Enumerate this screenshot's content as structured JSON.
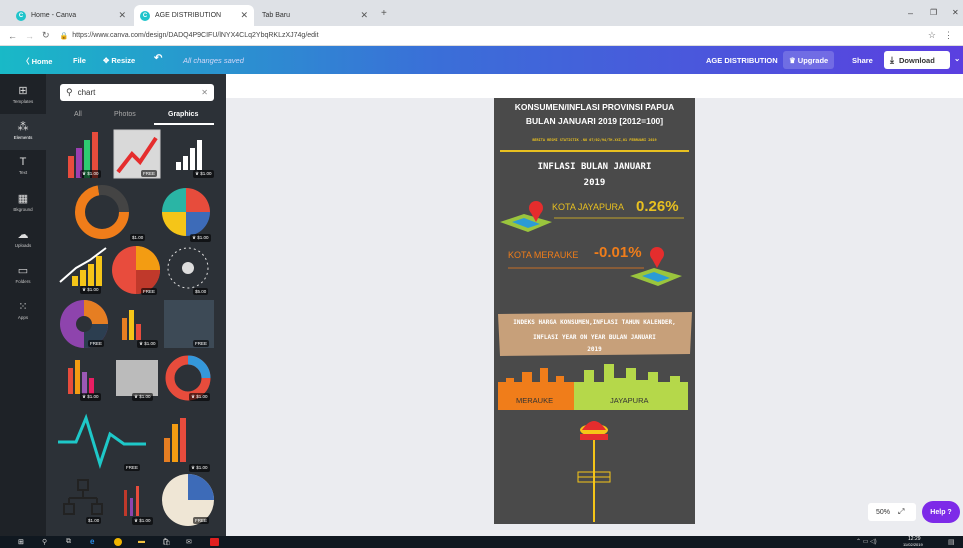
{
  "browser": {
    "tabs": [
      {
        "label": "Home - Canva"
      },
      {
        "label": "AGE DISTRIBUTION"
      },
      {
        "label": "Tab Baru"
      }
    ],
    "new_tab": "+",
    "url": "https://www.canva.com/design/DADQ4P9CIFU/lNYX4CLq2YbqRKLzXJ74g/edit",
    "window_controls": {
      "min": "–",
      "max": "❐",
      "close": "✕"
    }
  },
  "topbar": {
    "home": "〈 Home",
    "file": "File",
    "resize": "✥ Resize",
    "undo": "↶",
    "saved": "All changes saved",
    "title": "AGE DISTRIBUTION",
    "upgrade": "♛ Upgrade",
    "share": "Share",
    "download": "Download"
  },
  "rail": [
    {
      "label": "Templates",
      "icon": "⊞"
    },
    {
      "label": "Elements",
      "icon": "⁂"
    },
    {
      "label": "Text",
      "icon": "T"
    },
    {
      "label": "Bkground",
      "icon": "▦"
    },
    {
      "label": "Uploads",
      "icon": "☁"
    },
    {
      "label": "Folders",
      "icon": "▭"
    },
    {
      "label": "Apps",
      "icon": "⁙"
    }
  ],
  "panel": {
    "search_value": "chart",
    "tabs": [
      "All",
      "Photos",
      "Graphics"
    ],
    "price_labels": [
      "♛ $1.00",
      "FREE",
      "♛ $1.00",
      "$1.00",
      "♛ $1.00",
      "♛ $1.00",
      "FREE",
      "$5.00",
      "FREE",
      "♛ $1.00",
      "FREE",
      "♛ $1.00",
      "♛ $1.00",
      "♛ $1.00",
      "FREE",
      "♛ $1.00",
      "$1.00",
      "♛ $1.00",
      "FREE"
    ]
  },
  "design": {
    "title_line1": "KONSUMEN/INFLASI PROVINSI PAPUA",
    "title_line2": "BULAN JANUARI 2019 [2012=100]",
    "subtitle": "BERITA RESMI STATISTIK .NO 07/02/94/TH.XXI,01 FEBRUARI 2019",
    "heading1": "INFLASI BULAN JANUARI",
    "heading2": "2019",
    "city1_label": "KOTA JAYAPURA",
    "city1_value": "0.26%",
    "city2_label": "KOTA MERAUKE",
    "city2_value": "-0.01%",
    "banner1": "INDEKS HARGA KONSUMEN,INFLASI TAHUN KALENDER,",
    "banner2": "INFLASI YEAR ON YEAR BULAN JANUARI",
    "banner3": "2019",
    "skyline_left": "MERAUKE",
    "skyline_right": "JAYAPURA"
  },
  "zoom": {
    "value": "50%",
    "help": "Help ?"
  },
  "taskbar": {
    "time": "12:29",
    "date": "11/02/2019"
  }
}
